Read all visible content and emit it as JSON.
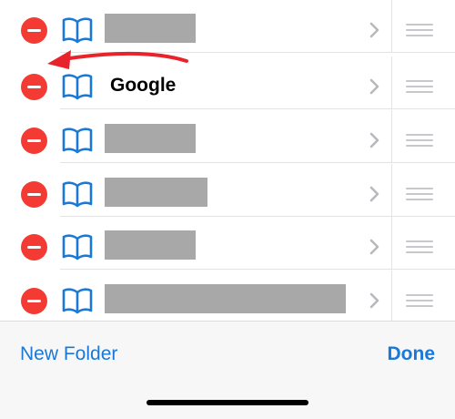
{
  "bookmarks": [
    {
      "title": "",
      "redacted": true,
      "redact_width": 100
    },
    {
      "title": "Google",
      "redacted": false,
      "redact_width": 0
    },
    {
      "title": "",
      "redacted": true,
      "redact_width": 100
    },
    {
      "title": "",
      "redacted": true,
      "redact_width": 113
    },
    {
      "title": "",
      "redacted": true,
      "redact_width": 100
    },
    {
      "title": "",
      "redacted": true,
      "redact_width": 265
    }
  ],
  "toolbar": {
    "new_folder_label": "New Folder",
    "done_label": "Done"
  },
  "colors": {
    "delete": "#f33b33",
    "accent": "#1a78d6",
    "annotation_arrow": "#e8232b"
  }
}
